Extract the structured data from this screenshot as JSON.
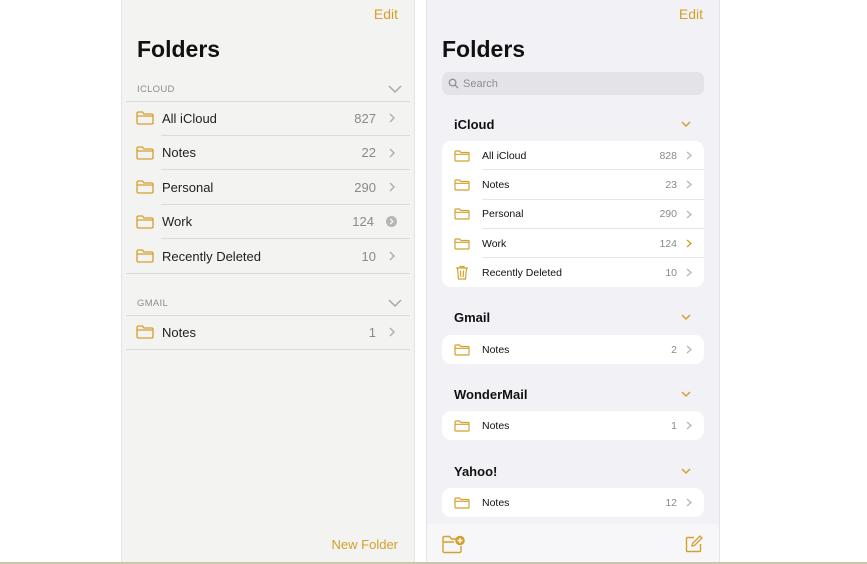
{
  "colors": {
    "accent": "#d4a02c",
    "trash_accent": "#d4a02c"
  },
  "left": {
    "edit_label": "Edit",
    "title": "Folders",
    "sections": [
      {
        "label": "ICLOUD",
        "items": [
          {
            "label": "All iCloud",
            "count": "827",
            "trailing": "chevron-right-icon"
          },
          {
            "label": "Notes",
            "count": "22",
            "trailing": "chevron-right-icon"
          },
          {
            "label": "Personal",
            "count": "290",
            "trailing": "chevron-right-icon"
          },
          {
            "label": "Work",
            "count": "124",
            "trailing": "info-icon"
          },
          {
            "label": "Recently Deleted",
            "count": "10",
            "trailing": "chevron-right-icon"
          }
        ]
      },
      {
        "label": "GMAIL",
        "items": [
          {
            "label": "Notes",
            "count": "1",
            "trailing": "chevron-right-icon"
          }
        ]
      }
    ],
    "new_folder_label": "New Folder"
  },
  "right": {
    "edit_label": "Edit",
    "title": "Folders",
    "search": {
      "placeholder": "Search",
      "value": ""
    },
    "sections": [
      {
        "label": "iCloud",
        "items": [
          {
            "label": "All iCloud",
            "count": "828",
            "icon": "folder-icon"
          },
          {
            "label": "Notes",
            "count": "23",
            "icon": "folder-icon"
          },
          {
            "label": "Personal",
            "count": "290",
            "icon": "folder-icon"
          },
          {
            "label": "Work",
            "count": "124",
            "icon": "folder-icon"
          },
          {
            "label": "Recently Deleted",
            "count": "10",
            "icon": "trash-icon"
          }
        ]
      },
      {
        "label": "Gmail",
        "items": [
          {
            "label": "Notes",
            "count": "2",
            "icon": "folder-icon"
          }
        ]
      },
      {
        "label": "WonderMail",
        "items": [
          {
            "label": "Notes",
            "count": "1",
            "icon": "folder-icon"
          }
        ]
      },
      {
        "label": "Yahoo!",
        "items": [
          {
            "label": "Notes",
            "count": "12",
            "icon": "folder-icon"
          }
        ]
      }
    ],
    "toolbar": {
      "new_folder_icon": "new-folder-icon",
      "compose_icon": "compose-icon"
    }
  }
}
